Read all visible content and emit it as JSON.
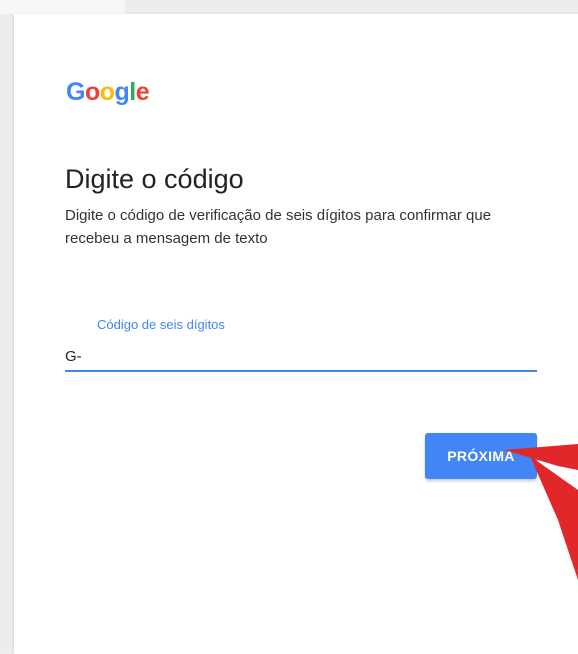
{
  "logo": {
    "letters": [
      {
        "char": "G",
        "color": "#4285f4"
      },
      {
        "char": "o",
        "color": "#ea4335"
      },
      {
        "char": "o",
        "color": "#fbbc05"
      },
      {
        "char": "g",
        "color": "#4285f4"
      },
      {
        "char": "l",
        "color": "#34a853"
      },
      {
        "char": "e",
        "color": "#ea4335"
      }
    ]
  },
  "main": {
    "title": "Digite o código",
    "description": "Digite o código de verificação de seis dígitos para confirmar que recebeu a mensagem de texto"
  },
  "code_field": {
    "label": "Código de seis dígitos",
    "value": "G-"
  },
  "next_button": {
    "label": "PRÓXIMA"
  },
  "colors": {
    "accent": "#4285f4",
    "arrow": "#e0282a"
  }
}
